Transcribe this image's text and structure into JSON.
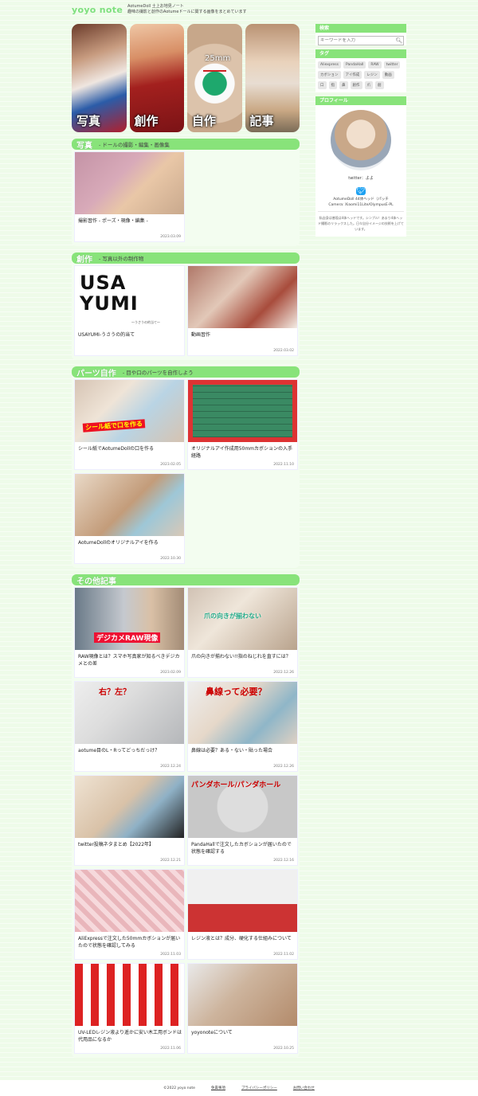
{
  "header": {
    "logo": "yoyo note",
    "tagline_1": "AotumeDoll 土上お地見ノート",
    "tagline_2": "趣味の撮影と創作のAotumeドールに関する画像をまとめています"
  },
  "hero": [
    {
      "label": "写真"
    },
    {
      "label": "創作"
    },
    {
      "label": "自作",
      "overlay": "25mm"
    },
    {
      "label": "記事"
    }
  ],
  "sections": {
    "photo": {
      "title": "写真",
      "sub": "- ドールの撮影・編集・画像集"
    },
    "create": {
      "title": "創作",
      "sub": "- 写真以外の制作物"
    },
    "parts": {
      "title": "パーツ自作",
      "sub": "- 目や口のパーツを自作しよう"
    },
    "other": {
      "title": "その他記事",
      "sub": ""
    }
  },
  "cards": {
    "photo": [
      {
        "title": "撮影習作 - ポーズ・現像・編集 -",
        "date": "2023.03.09"
      }
    ],
    "create": [
      {
        "title": "USAYUMI-うさうの的当て",
        "date": "",
        "logo_text": "USA\nYUMI",
        "logo_sub": "〜うさうの的当て〜"
      },
      {
        "title": "動画習作",
        "date": "2022.03.02"
      }
    ],
    "parts": [
      {
        "title": "シール紙でAotumeDollの口を作る",
        "date": "2023.02.05",
        "overlay": "シール紙で口を作る"
      },
      {
        "title": "オリジナルアイ作成用50mmカボションの入手経路",
        "date": "2022.11.10"
      },
      {
        "title": "AotumeDollのオリジナルアイを作る",
        "date": "2022.10.30"
      }
    ],
    "other": [
      {
        "title": "RAW現像とは？スマホ写真家が知るべきデジカメとの差",
        "date": "2023.02.09",
        "overlay": "デジカメRAW現像"
      },
      {
        "title": "爪の向きが揃わない!!指のねじれを直すには？",
        "date": "2022.12.26",
        "overlay": "爪の向きが揃わない"
      },
      {
        "title": "aotume目のL・Rってどっちだっけ？",
        "date": "2022.12.24",
        "overlay": "右？左？"
      },
      {
        "title": "鼻線は必要？ある・ない・貼った場合",
        "date": "2022.12.26",
        "overlay": "鼻線って必要？"
      },
      {
        "title": "twitter投稿ネタまとめ【2022年】",
        "date": "2022.12.21"
      },
      {
        "title": "PandaHallで注文したカボションが届いたので状態を確認する",
        "date": "2022.12.16",
        "overlay": "パンダホール/パンダホール"
      },
      {
        "title": "AliExpressで注文した50mmカボションが届いたので状態を確認してみる",
        "date": "2022.11.03"
      },
      {
        "title": "レジン液とは？成分、硬化する仕組みについて",
        "date": "2022.11.02"
      },
      {
        "title": "UV-LEDレジン液より遥かに安い木工用ボンドは代用品になるか",
        "date": "2022.11.06"
      },
      {
        "title": "yoyonoteについて",
        "date": "2022.10.25"
      }
    ]
  },
  "sidebar": {
    "search": {
      "heading": "検索",
      "placeholder": "キーワードを入力"
    },
    "tags": {
      "heading": "タグ",
      "items": [
        "Aliexpress",
        "PandaHall",
        "RAW",
        "twitter",
        "カボション",
        "アイ作成",
        "レジン",
        "動画",
        "口",
        "指",
        "鼻",
        "創作",
        "爪",
        "創"
      ]
    },
    "profile": {
      "heading": "プロフィール",
      "name": "twitter：よよ",
      "meta_1": "AotumeDoll 44体ヘッド（パッチ",
      "meta_2": "Camera: Xiaomi11Lite/OlympusE-PL",
      "desc": "私自身は普段は4体ヘッドです。シンプル！あまり4体ヘッド撮影のリラックスした。日々自分イメージの技術を上げています。"
    }
  },
  "footer": {
    "copyright": "©2022 yoyo note",
    "link_1": "免責事項",
    "link_2": "プライバシーポリシー",
    "link_3": "お問い合わせ"
  }
}
